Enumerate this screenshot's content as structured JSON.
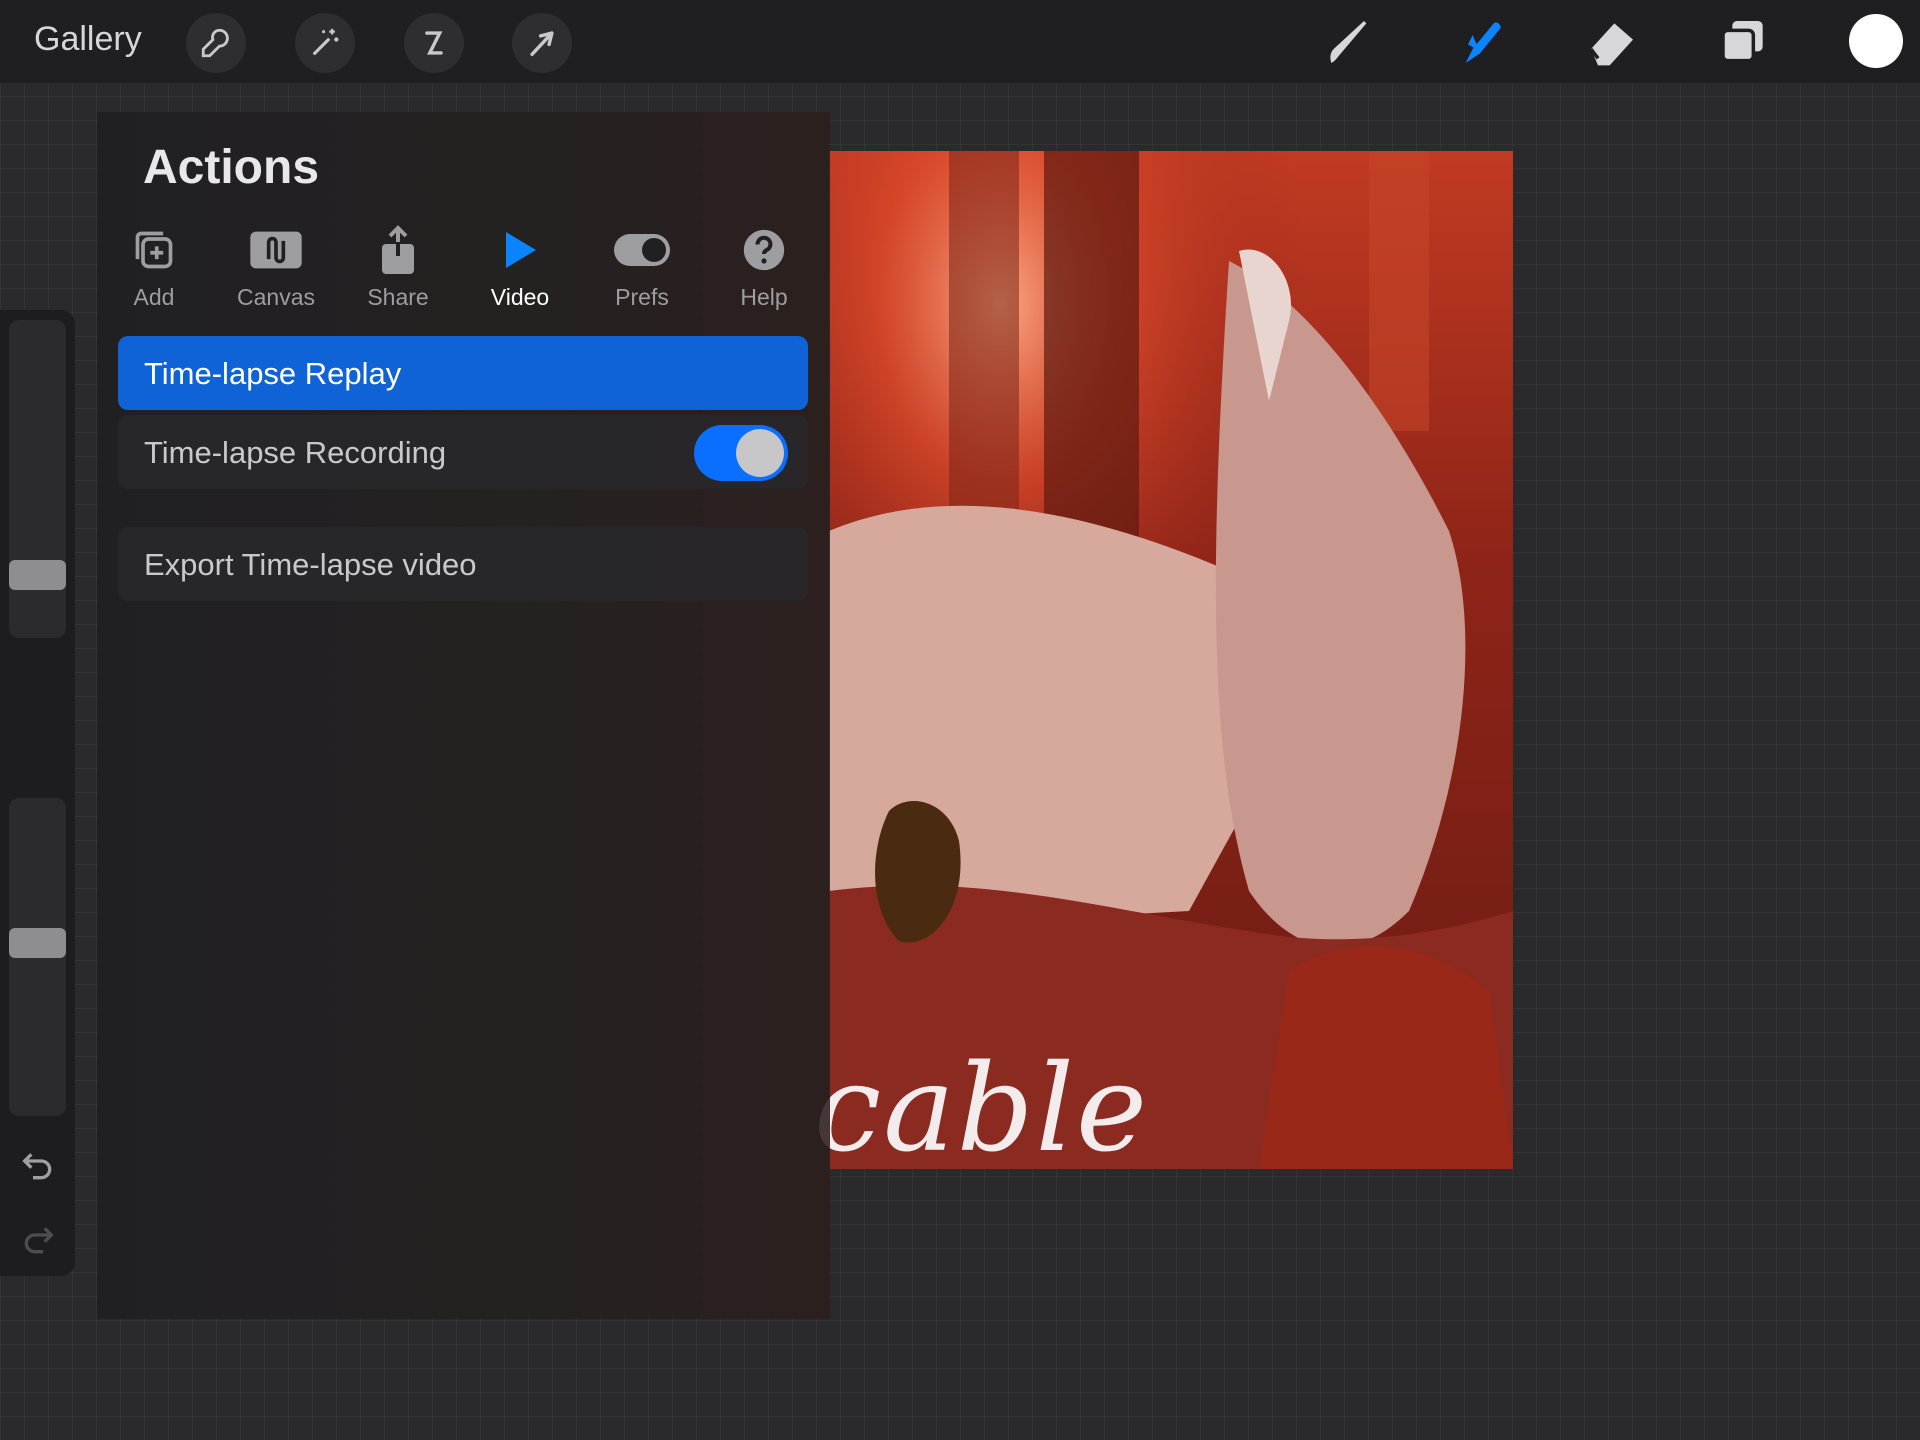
{
  "topbar": {
    "gallery_label": "Gallery",
    "tools_left": [
      "wrench-icon",
      "magic-wand-icon",
      "selection-icon",
      "transform-arrow-icon"
    ],
    "tools_right": [
      "brush-icon",
      "smudge-icon",
      "eraser-icon",
      "layers-icon"
    ],
    "active_tool": "smudge-icon",
    "current_color": "#ffffff"
  },
  "actions": {
    "title": "Actions",
    "tabs": [
      {
        "label": "Add",
        "icon": "add-icon"
      },
      {
        "label": "Canvas",
        "icon": "canvas-icon"
      },
      {
        "label": "Share",
        "icon": "share-icon"
      },
      {
        "label": "Video",
        "icon": "play-icon"
      },
      {
        "label": "Prefs",
        "icon": "toggle-prefs-icon"
      },
      {
        "label": "Help",
        "icon": "help-icon"
      }
    ],
    "active_tab": "Video",
    "items": {
      "replay": "Time-lapse Replay",
      "recording": "Time-lapse Recording",
      "export": "Export Time-lapse video"
    },
    "recording_enabled": true
  },
  "artwork": {
    "visible_text": "cable"
  },
  "colors": {
    "accent": "#0a6fff",
    "selected_row": "#0f63d6",
    "panel_bg": "#202022"
  }
}
